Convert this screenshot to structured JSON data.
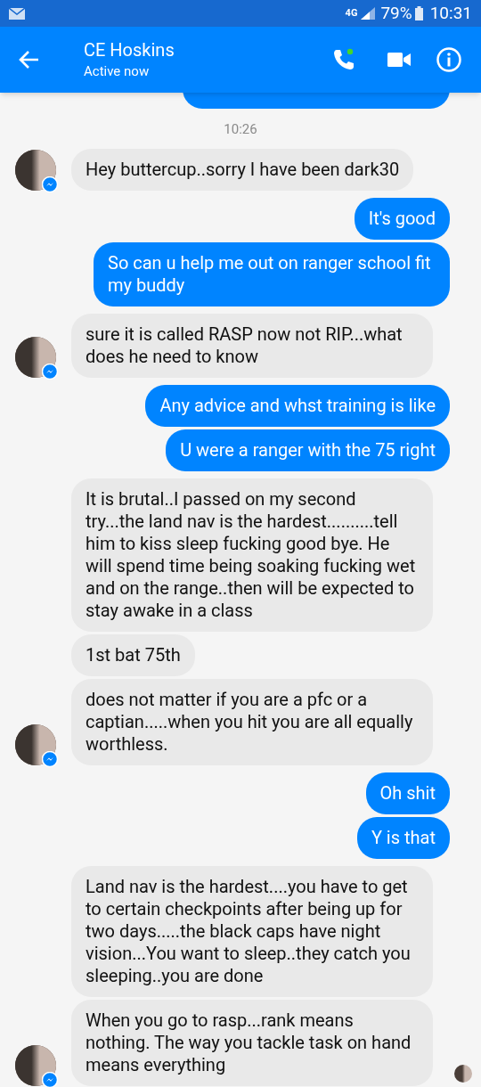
{
  "status_bar": {
    "network": "4G",
    "battery": "79%",
    "time": "10:31"
  },
  "header": {
    "name": "CE Hoskins",
    "status": "Active now",
    "call_active": true
  },
  "timestamp": "10:26",
  "messages": [
    {
      "kind": "received",
      "text": "Hey buttercup..sorry I have been dark30",
      "avatar": true,
      "read_receipt": false
    },
    {
      "kind": "sent",
      "text": "It's good"
    },
    {
      "kind": "sent",
      "text": "So can u help me out on ranger school fit my buddy"
    },
    {
      "kind": "received",
      "text": "sure it is called RASP now not RIP...what does he need to know",
      "avatar": true,
      "read_receipt": false
    },
    {
      "kind": "sent",
      "text": "Any advice and whst training is like"
    },
    {
      "kind": "sent",
      "text": "U were a ranger with the 75 right"
    },
    {
      "kind": "received",
      "text": "It is brutal..I passed on my second try...the land nav is the hardest..........tell him to kiss sleep fucking good bye. He will spend time being soaking fucking wet and on the range..then will be expected to stay awake in a class",
      "avatar": false,
      "read_receipt": false
    },
    {
      "kind": "received",
      "text": "1st bat 75th",
      "avatar": false,
      "read_receipt": false
    },
    {
      "kind": "received",
      "text": "does not matter if you are a pfc or a captian.....when you hit you are all equally worthless.",
      "avatar": true,
      "read_receipt": false
    },
    {
      "kind": "sent",
      "text": "Oh shit"
    },
    {
      "kind": "sent",
      "text": "Y is that"
    },
    {
      "kind": "received",
      "text": "Land nav is the hardest....you have to get to certain checkpoints after being up for two days.....the black caps have night vision...You want to sleep..they catch you sleeping..you are done",
      "avatar": false,
      "read_receipt": false
    },
    {
      "kind": "received",
      "text": "When you go to rasp...rank means nothing. The way you tackle task on hand means everything",
      "avatar": true,
      "read_receipt": true
    }
  ]
}
